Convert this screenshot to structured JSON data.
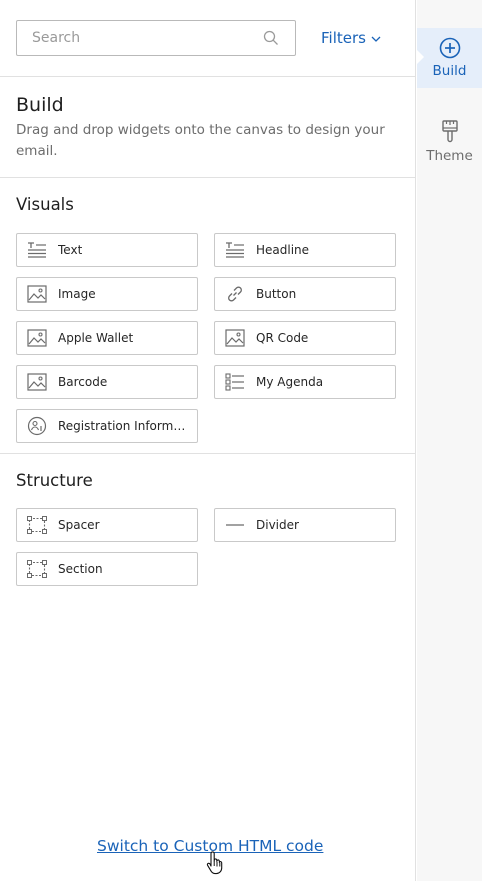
{
  "search": {
    "placeholder": "Search"
  },
  "filters": {
    "label": "Filters"
  },
  "build": {
    "title": "Build",
    "description": "Drag and drop widgets onto the canvas to design your email."
  },
  "visuals": {
    "title": "Visuals",
    "items": [
      {
        "label": "Text",
        "icon": "text-icon"
      },
      {
        "label": "Headline",
        "icon": "headline-icon"
      },
      {
        "label": "Image",
        "icon": "image-icon"
      },
      {
        "label": "Button",
        "icon": "link-icon"
      },
      {
        "label": "Apple Wallet",
        "icon": "image-icon"
      },
      {
        "label": "QR Code",
        "icon": "image-icon"
      },
      {
        "label": "Barcode",
        "icon": "image-icon"
      },
      {
        "label": "My Agenda",
        "icon": "agenda-icon"
      },
      {
        "label": "Registration Information",
        "icon": "registration-icon"
      }
    ]
  },
  "structure": {
    "title": "Structure",
    "items": [
      {
        "label": "Spacer",
        "icon": "spacer-icon"
      },
      {
        "label": "Divider",
        "icon": "divider-icon"
      },
      {
        "label": "Section",
        "icon": "section-icon"
      }
    ]
  },
  "footer": {
    "custom_html_link": "Switch to Custom HTML code"
  },
  "rail": {
    "items": [
      {
        "label": "Build",
        "icon": "plus-circle-icon",
        "active": true
      },
      {
        "label": "Theme",
        "icon": "paintbrush-icon",
        "active": false
      }
    ]
  },
  "colors": {
    "accent": "#1a63b8",
    "rail_bg": "#f7f7f7",
    "active_bg": "#e5eefa",
    "border": "#c9c9c9"
  }
}
